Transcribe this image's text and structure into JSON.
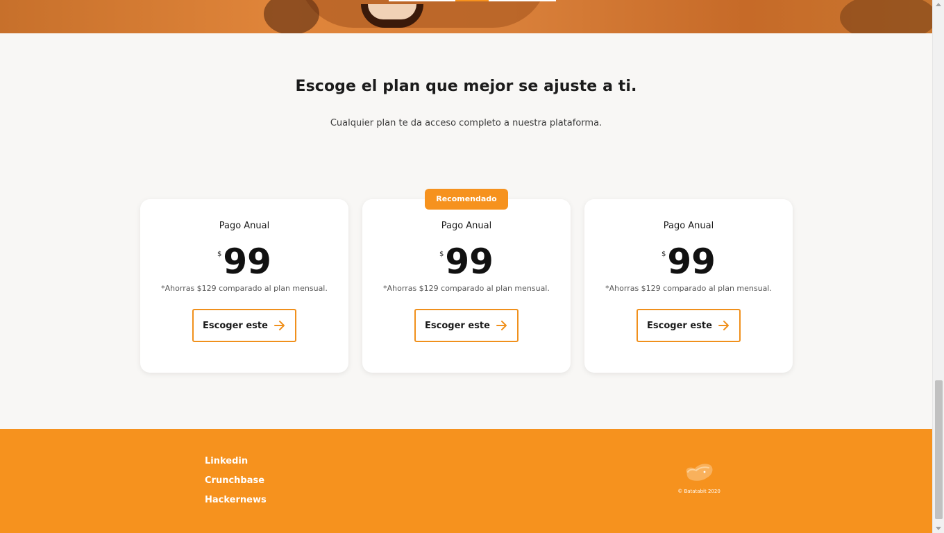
{
  "pricing": {
    "title": "Escoge el plan que mejor se ajuste a ti.",
    "subtitle": "Cualquier plan te da acceso completo a nuestra plataforma.",
    "recommended_badge": "Recomendado",
    "plans": [
      {
        "name": "Pago Anual",
        "currency": "$",
        "price": "99",
        "note": "*Ahorras $129 comparado al plan mensual.",
        "button": "Escoger este"
      },
      {
        "name": "Pago Anual",
        "currency": "$",
        "price": "99",
        "note": "*Ahorras $129 comparado al plan mensual.",
        "button": "Escoger este"
      },
      {
        "name": "Pago Anual",
        "currency": "$",
        "price": "99",
        "note": "*Ahorras $129 comparado al plan mensual.",
        "button": "Escoger este"
      }
    ]
  },
  "footer": {
    "links": [
      "Linkedin",
      "Crunchbase",
      "Hackernews"
    ],
    "copyright": "© Batatabit 2020",
    "logo_icon": "batatabit-logo-icon"
  },
  "colors": {
    "accent": "#f6921e",
    "background": "#f8f7f5",
    "card": "#ffffff"
  },
  "icons": {
    "button_arrow": "arrow-right-icon"
  }
}
